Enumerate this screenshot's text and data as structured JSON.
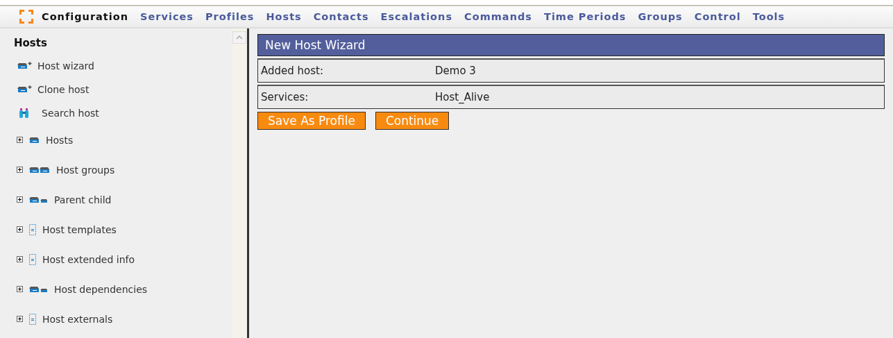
{
  "nav": [
    {
      "label": "Configuration",
      "selected": true
    },
    {
      "label": "Services",
      "selected": false
    },
    {
      "label": "Profiles",
      "selected": false
    },
    {
      "label": "Hosts",
      "selected": false
    },
    {
      "label": "Contacts",
      "selected": false
    },
    {
      "label": "Escalations",
      "selected": false
    },
    {
      "label": "Commands",
      "selected": false
    },
    {
      "label": "Time Periods",
      "selected": false
    },
    {
      "label": "Groups",
      "selected": false
    },
    {
      "label": "Control",
      "selected": false
    },
    {
      "label": "Tools",
      "selected": false
    }
  ],
  "sidebar": {
    "title": "Hosts",
    "items": [
      {
        "kind": "action",
        "label": "Host wizard"
      },
      {
        "kind": "action",
        "label": "Clone host"
      },
      {
        "kind": "action",
        "label": "Search host"
      },
      {
        "kind": "tree",
        "label": "Hosts",
        "expanded": false
      },
      {
        "kind": "tree",
        "label": "Host groups",
        "expanded": false
      },
      {
        "kind": "tree",
        "label": "Parent child",
        "expanded": false
      },
      {
        "kind": "tree",
        "label": "Host templates",
        "expanded": false
      },
      {
        "kind": "tree",
        "label": "Host extended info",
        "expanded": false
      },
      {
        "kind": "tree",
        "label": "Host dependencies",
        "expanded": false
      },
      {
        "kind": "tree",
        "label": "Host externals",
        "expanded": false
      }
    ]
  },
  "wizard": {
    "title": "New Host Wizard",
    "rows": [
      {
        "label": "Added host:",
        "value": "Demo 3"
      },
      {
        "label": "Services:",
        "value": "Host_Alive"
      }
    ],
    "buttons": [
      "Save As Profile",
      "Continue"
    ]
  }
}
